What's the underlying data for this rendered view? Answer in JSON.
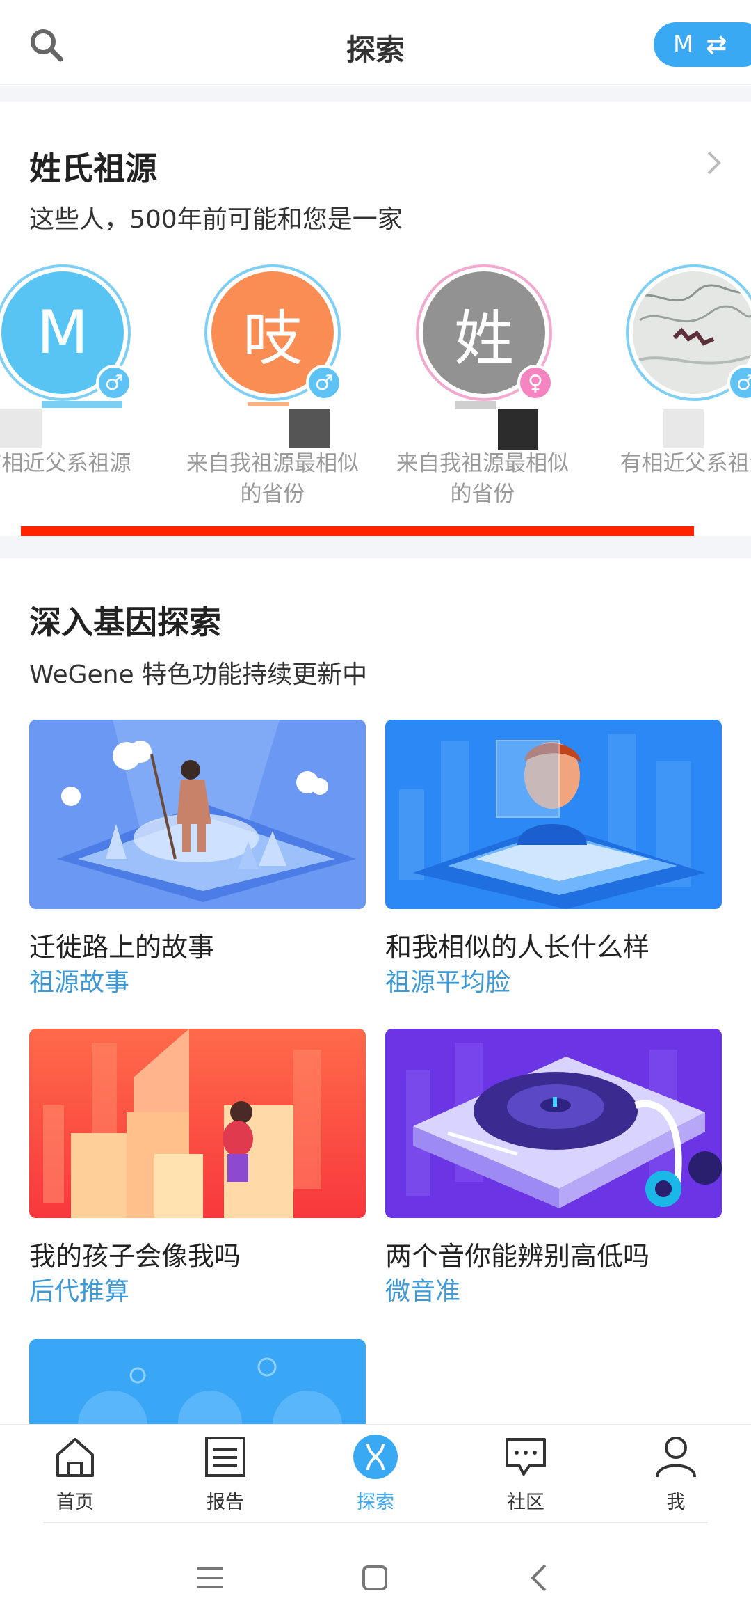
{
  "header": {
    "title": "探索",
    "switch_label": "M",
    "switch_icon": "⇄",
    "accent": "#3aa9f4"
  },
  "surname": {
    "title": "姓氏祖源",
    "subtitle": "这些人，500年前可能和您是一家",
    "people": [
      {
        "letter": "M",
        "color": "#57c4f3",
        "gender": "male",
        "label": "有相近父系祖源"
      },
      {
        "letter": "吱",
        "color": "#f98d54",
        "gender": "male",
        "label": "来自我祖源最相似的省份"
      },
      {
        "letter": "姓",
        "color": "#929292",
        "gender": "female",
        "label": "来自我祖源最相似的省份"
      },
      {
        "letter": "",
        "color": "#d7dbd6",
        "gender": "male",
        "label": "有相近父系祖源"
      }
    ]
  },
  "explore": {
    "title": "深入基因探索",
    "subtitle": "WeGene 特色功能持续更新中",
    "cards": [
      {
        "title": "迁徙路上的故事",
        "tag": "祖源故事"
      },
      {
        "title": "和我相似的人长什么样",
        "tag": "祖源平均脸"
      },
      {
        "title": "我的孩子会像我吗",
        "tag": "后代推算"
      },
      {
        "title": "两个音你能辨别高低吗",
        "tag": "微音准"
      }
    ]
  },
  "nav": {
    "items": [
      {
        "label": "首页",
        "icon": "home-icon"
      },
      {
        "label": "报告",
        "icon": "report-icon"
      },
      {
        "label": "探索",
        "icon": "dna-icon",
        "active": true
      },
      {
        "label": "社区",
        "icon": "chat-icon"
      },
      {
        "label": "我",
        "icon": "person-icon"
      }
    ]
  }
}
